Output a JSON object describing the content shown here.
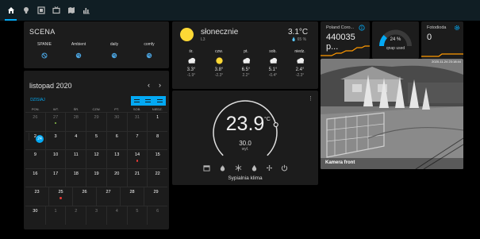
{
  "toolbar": {
    "tabs": [
      {
        "icon": "home-icon",
        "active": true
      },
      {
        "icon": "lightbulb-icon",
        "active": false
      },
      {
        "icon": "image-grid-icon",
        "active": false
      },
      {
        "icon": "tv-icon",
        "active": false
      },
      {
        "icon": "map-icon",
        "active": false
      },
      {
        "icon": "chart-bar-icon",
        "active": false
      }
    ]
  },
  "scene": {
    "title": "SCENA",
    "buttons": [
      {
        "label": "SPANIE",
        "icon": "sleep-icon"
      },
      {
        "label": "Ambient",
        "icon": "palette-icon"
      },
      {
        "label": "daily",
        "icon": "palette-icon"
      },
      {
        "label": "comfy",
        "icon": "palette-icon"
      }
    ]
  },
  "calendar": {
    "month": "listopad 2020",
    "today_label": "DZISIAJ",
    "prev_icon": "chevron-left-icon",
    "next_icon": "chevron-right-icon",
    "view_icons": [
      "view-month-icon",
      "view-week-icon",
      "view-day-icon"
    ],
    "weekdays": [
      "PON.",
      "WT.",
      "ŚR.",
      "CZW.",
      "PT.",
      "SOB.",
      "NIEDZ."
    ],
    "weeks": [
      [
        {
          "d": "26",
          "o": 1
        },
        {
          "d": "27",
          "o": 1,
          "dot": "#8bc34a"
        },
        {
          "d": "28",
          "o": 1
        },
        {
          "d": "29",
          "o": 1
        },
        {
          "d": "30",
          "o": 1
        },
        {
          "d": "31",
          "o": 1
        },
        {
          "d": "1"
        }
      ],
      [
        {
          "d": "2"
        },
        {
          "d": "3"
        },
        {
          "d": "4"
        },
        {
          "d": "5"
        },
        {
          "d": "6"
        },
        {
          "d": "7"
        },
        {
          "d": "8"
        }
      ],
      [
        {
          "d": "9"
        },
        {
          "d": "10"
        },
        {
          "d": "11"
        },
        {
          "d": "12"
        },
        {
          "d": "13"
        },
        {
          "d": "14",
          "dot": "#e53935"
        },
        {
          "d": "15"
        }
      ],
      [
        {
          "d": "16"
        },
        {
          "d": "17"
        },
        {
          "d": "18"
        },
        {
          "d": "19"
        },
        {
          "d": "20"
        },
        {
          "d": "21"
        },
        {
          "d": "22"
        }
      ],
      [
        {
          "d": "23"
        },
        {
          "d": "24",
          "today": 1
        },
        {
          "d": "25",
          "dot": "#e53935"
        },
        {
          "d": "26"
        },
        {
          "d": "27"
        },
        {
          "d": "28"
        },
        {
          "d": "29"
        }
      ],
      [
        {
          "d": "30"
        },
        {
          "d": "1",
          "o": 1
        },
        {
          "d": "2",
          "o": 1
        },
        {
          "d": "3",
          "o": 1
        },
        {
          "d": "4",
          "o": 1
        },
        {
          "d": "5",
          "o": 1
        },
        {
          "d": "6",
          "o": 1
        }
      ]
    ]
  },
  "weather": {
    "condition": "słonecznie",
    "location": "L3",
    "temperature": "3.1°C",
    "humidity": "65 %",
    "forecast": [
      {
        "day": "śr.",
        "icon": "cloudy-icon",
        "hi": "3.3°",
        "lo": "-1.9°"
      },
      {
        "day": "czw.",
        "icon": "sunny-icon",
        "hi": "3.8°",
        "lo": "-2.3°"
      },
      {
        "day": "pt.",
        "icon": "cloudy-icon",
        "hi": "6.5°",
        "lo": "2.2°"
      },
      {
        "day": "sob.",
        "icon": "cloudy-icon",
        "hi": "5.1°",
        "lo": "-0.4°"
      },
      {
        "day": "niedz.",
        "icon": "cloudy-icon",
        "hi": "2.4°",
        "lo": "-2.3°"
      }
    ]
  },
  "thermostat": {
    "current": "23.9",
    "unit": "°C",
    "target": "30.0",
    "mode": "wył.",
    "name": "Sypialnia klima",
    "level": 0.78,
    "modes": [
      "calendar-icon",
      "flame-icon",
      "snowflake-icon",
      "water-icon",
      "fan-icon",
      "power-icon"
    ]
  },
  "sensors": {
    "corona": {
      "label": "Poland Coro...",
      "value": "440035 p...",
      "icon": "info-icon",
      "accent": "#ff9800"
    },
    "qnap": {
      "value": "24 %",
      "label": "qnap used",
      "level": 0.24,
      "accent": "#03a9f4"
    },
    "photo": {
      "label": "Fotodioda",
      "value": "0",
      "icon": "gear-icon",
      "accent": "#ff9800"
    }
  },
  "camera": {
    "timestamp": "2020-11-24 23:18:44",
    "caption": "Kamera front"
  },
  "colors": {
    "accent": "#03a9f4",
    "card": "#1c1c1c",
    "sun": "#fdd835"
  }
}
